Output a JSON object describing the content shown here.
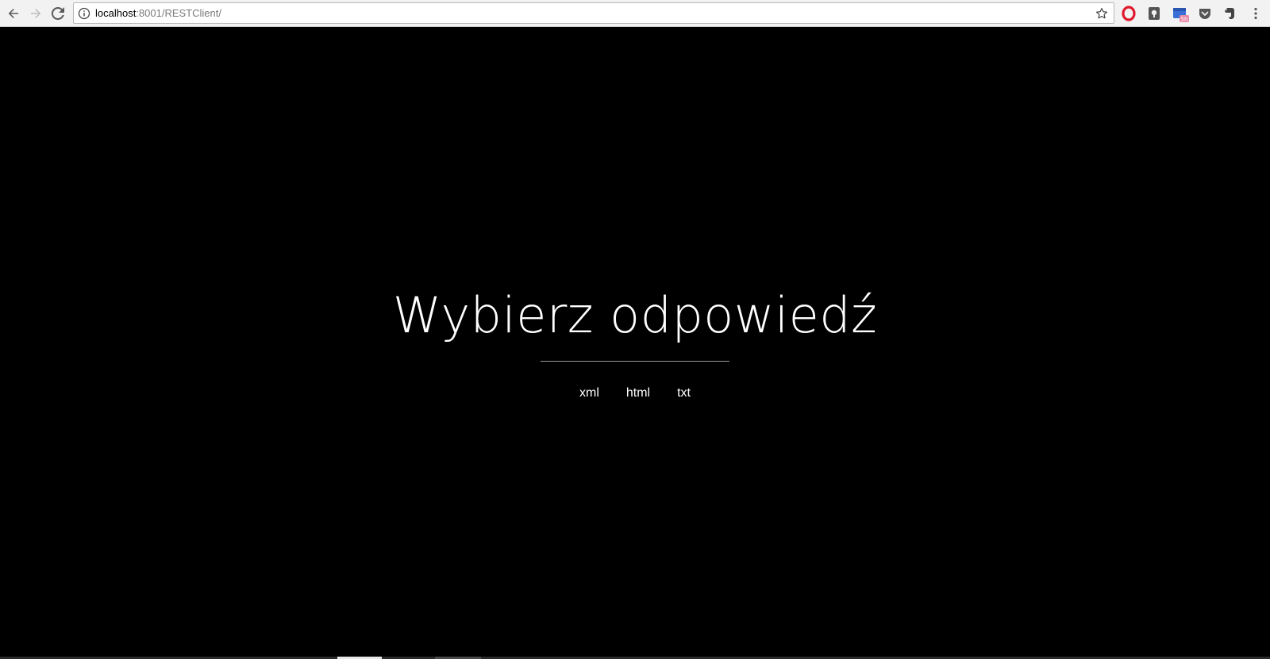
{
  "browser": {
    "url_host": "localhost",
    "url_path": ":8001/RESTClient/",
    "icons": {
      "back": "back-arrow-icon",
      "forward": "forward-arrow-icon",
      "reload": "reload-icon",
      "info": "info-icon",
      "bookmark": "star-icon",
      "menu": "menu-dots-icon"
    },
    "extensions": [
      {
        "name": "opera-icon",
        "color": "#e0192c"
      },
      {
        "name": "keeper-icon",
        "color": "#555555"
      },
      {
        "name": "calendar-icon",
        "color": "#3a6fd8",
        "badge": "5h",
        "badge_color": "#e88aa8"
      },
      {
        "name": "pocket-icon",
        "color": "#555555"
      },
      {
        "name": "evernote-icon",
        "color": "#444444"
      }
    ]
  },
  "page": {
    "title": "Wybierz odpowiedź",
    "options": [
      {
        "label": "xml"
      },
      {
        "label": "html"
      },
      {
        "label": "txt"
      }
    ],
    "colors": {
      "background": "#000000",
      "text": "#ffffff",
      "divider": "#9a9a9a"
    }
  }
}
